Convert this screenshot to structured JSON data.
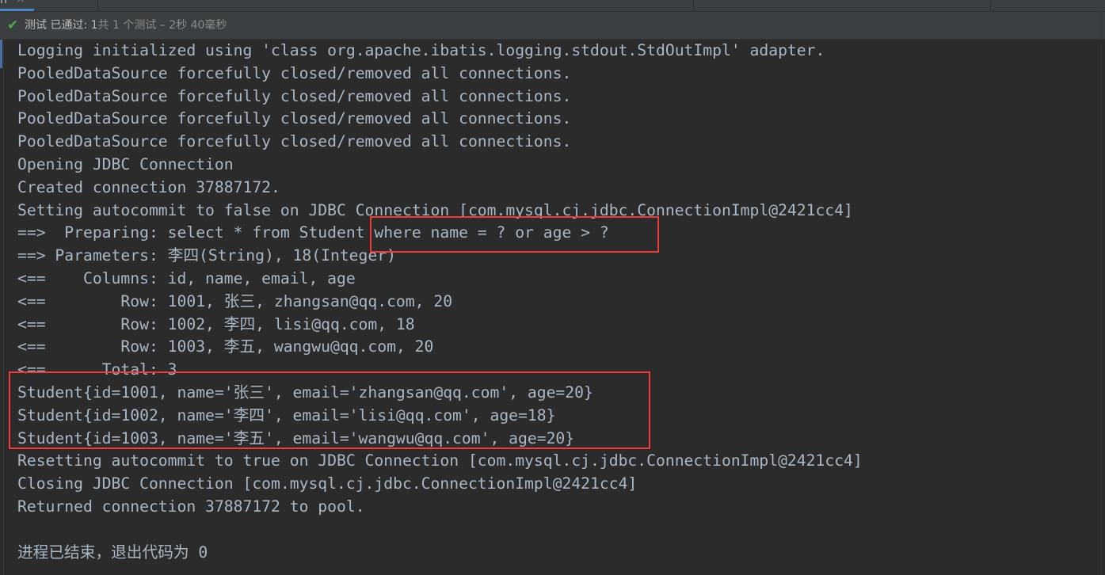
{
  "tab": {
    "label": "n",
    "close_icon": "close-icon"
  },
  "status": {
    "icon": "check-icon",
    "passed_label": "测试 已通过: 1",
    "summary": "共 1 个测试 – 2秒 40毫秒",
    "colors": {
      "check": "#4fa64f"
    }
  },
  "console": {
    "lines": [
      "Logging initialized using 'class org.apache.ibatis.logging.stdout.StdOutImpl' adapter.",
      "PooledDataSource forcefully closed/removed all connections.",
      "PooledDataSource forcefully closed/removed all connections.",
      "PooledDataSource forcefully closed/removed all connections.",
      "PooledDataSource forcefully closed/removed all connections.",
      "Opening JDBC Connection",
      "Created connection 37887172.",
      "Setting autocommit to false on JDBC Connection [com.mysql.cj.jdbc.ConnectionImpl@2421cc4]",
      "==>  Preparing: select * from Student where name = ? or age > ?",
      "==> Parameters: 李四(String), 18(Integer)",
      "<==    Columns: id, name, email, age",
      "<==        Row: 1001, 张三, zhangsan@qq.com, 20",
      "<==        Row: 1002, 李四, lisi@qq.com, 18",
      "<==        Row: 1003, 李五, wangwu@qq.com, 20",
      "<==      Total: 3",
      "Student{id=1001, name='张三', email='zhangsan@qq.com', age=20}",
      "Student{id=1002, name='李四', email='lisi@qq.com', age=18}",
      "Student{id=1003, name='李五', email='wangwu@qq.com', age=20}",
      "Resetting autocommit to true on JDBC Connection [com.mysql.cj.jdbc.ConnectionImpl@2421cc4]",
      "Closing JDBC Connection [com.mysql.cj.jdbc.ConnectionImpl@2421cc4]",
      "Returned connection 37887172 to pool.",
      "",
      "进程已结束，退出代码为 0"
    ],
    "text_color": "#a9b7c6",
    "highlight_color": "#f03a3a"
  }
}
